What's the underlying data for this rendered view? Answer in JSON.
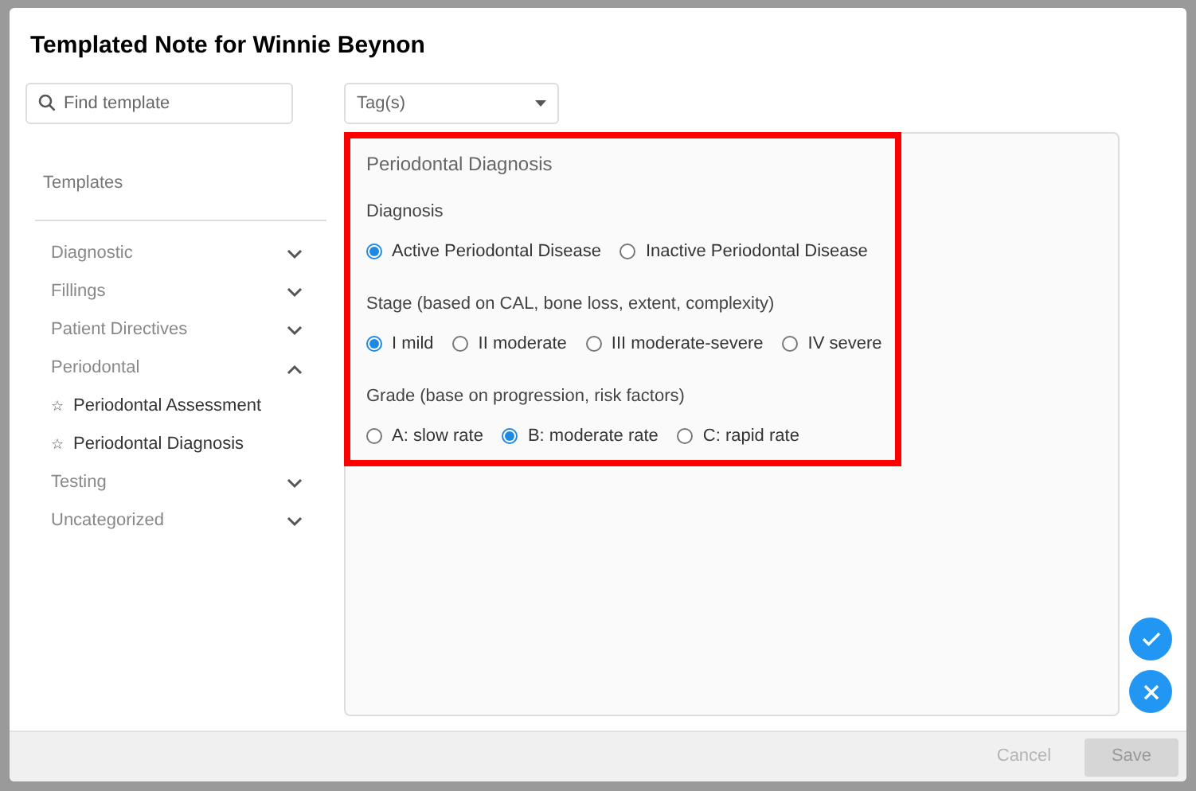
{
  "dialog": {
    "title": "Templated Note for Winnie Beynon"
  },
  "search": {
    "placeholder": "Find template"
  },
  "tags": {
    "placeholder": "Tag(s)"
  },
  "sidebar": {
    "heading": "Templates",
    "items": [
      {
        "label": "Diagnostic",
        "expanded": false
      },
      {
        "label": "Fillings",
        "expanded": false
      },
      {
        "label": "Patient Directives",
        "expanded": false
      },
      {
        "label": "Periodontal",
        "expanded": true,
        "children": [
          {
            "icon": "☆",
            "label": "Periodontal Assessment"
          },
          {
            "icon": "☆",
            "label": "Periodontal Diagnosis"
          }
        ]
      },
      {
        "label": "Testing",
        "expanded": false
      },
      {
        "label": "Uncategorized",
        "expanded": false
      }
    ]
  },
  "form": {
    "title": "Periodontal Diagnosis",
    "highlighted": true,
    "groups": [
      {
        "label": "Diagnosis",
        "options": [
          {
            "label": "Active Periodontal Disease",
            "selected": true
          },
          {
            "label": "Inactive Periodontal Disease",
            "selected": false
          }
        ]
      },
      {
        "label": "Stage (based on CAL, bone loss, extent, complexity)",
        "options": [
          {
            "label": "I mild",
            "selected": true
          },
          {
            "label": "II moderate",
            "selected": false
          },
          {
            "label": "III moderate-severe",
            "selected": false
          },
          {
            "label": "IV severe",
            "selected": false
          }
        ]
      },
      {
        "label": "Grade (base on progression, risk factors)",
        "options": [
          {
            "label": "A: slow rate",
            "selected": false
          },
          {
            "label": "B: moderate rate",
            "selected": true
          },
          {
            "label": "C: rapid rate",
            "selected": false
          }
        ]
      }
    ]
  },
  "footer": {
    "buttons": [
      {
        "label": "Cancel",
        "kind": "text",
        "disabled": true
      },
      {
        "label": "Save",
        "kind": "filled",
        "disabled": true
      }
    ]
  }
}
